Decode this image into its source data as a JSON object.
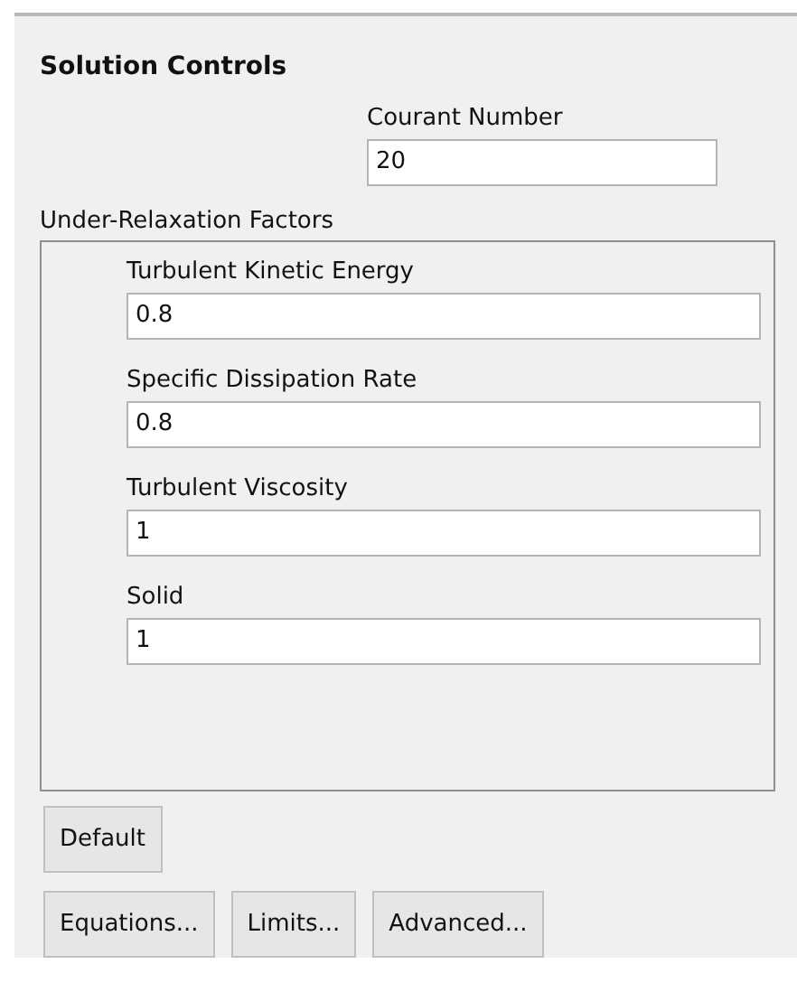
{
  "panel": {
    "title": "Solution Controls"
  },
  "courant": {
    "label": "Courant Number",
    "value": "20"
  },
  "under_relaxation": {
    "title": "Under-Relaxation Factors",
    "factors": [
      {
        "label": "Turbulent Kinetic Energy",
        "value": "0.8"
      },
      {
        "label": "Specific Dissipation Rate",
        "value": "0.8"
      },
      {
        "label": "Turbulent Viscosity",
        "value": "1"
      },
      {
        "label": "Solid",
        "value": "1"
      }
    ]
  },
  "default_button": "Default",
  "buttons": [
    "Equations...",
    "Limits...",
    "Advanced..."
  ]
}
